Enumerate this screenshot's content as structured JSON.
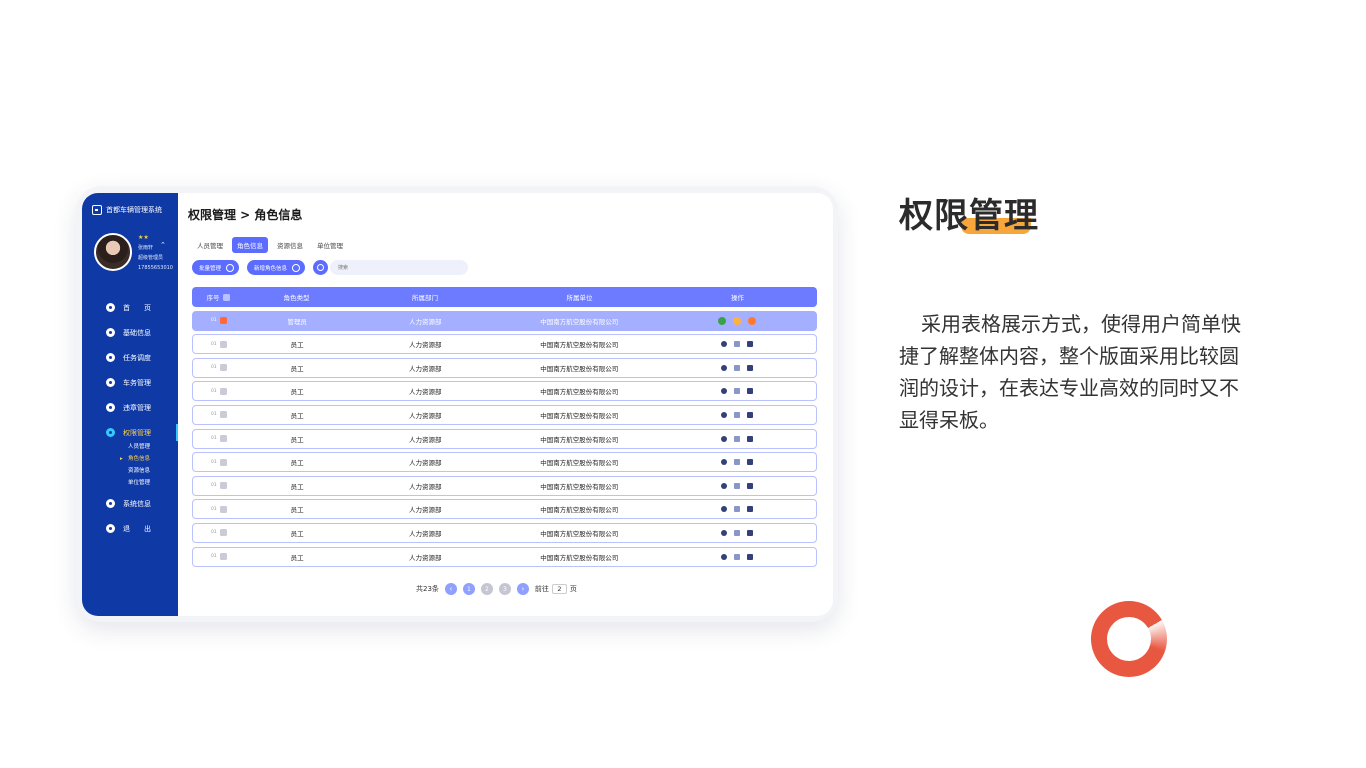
{
  "app": {
    "title": "首都车辆管理系统"
  },
  "user": {
    "name": "张雨轩",
    "role": "超级管理员",
    "phone": "17855653010"
  },
  "nav": {
    "items": [
      {
        "label": "首　　页"
      },
      {
        "label": "基础信息"
      },
      {
        "label": "任务调度"
      },
      {
        "label": "车务管理"
      },
      {
        "label": "违章管理"
      },
      {
        "label": "权限管理"
      },
      {
        "label": "系统信息"
      },
      {
        "label": "退　　出"
      }
    ],
    "sub": [
      "人员管理",
      "角色信息",
      "资源信息",
      "单位管理"
    ]
  },
  "breadcrumb": "权限管理 > 角色信息",
  "tabs": [
    "人员管理",
    "角色信息",
    "资源信息",
    "单位管理"
  ],
  "toolbar": {
    "batch_label": "批量管理",
    "add_label": "新增角色信息",
    "search_placeholder": "搜索"
  },
  "table": {
    "headers": [
      "序号",
      "角色类型",
      "所属部门",
      "所属单位",
      "操作"
    ],
    "rows": [
      {
        "no": "01",
        "role": "管理员",
        "dept": "人力资源部",
        "unit": "中国南方航空股份有限公司"
      },
      {
        "no": "01",
        "role": "员工",
        "dept": "人力资源部",
        "unit": "中国南方航空股份有限公司"
      },
      {
        "no": "01",
        "role": "员工",
        "dept": "人力资源部",
        "unit": "中国南方航空股份有限公司"
      },
      {
        "no": "01",
        "role": "员工",
        "dept": "人力资源部",
        "unit": "中国南方航空股份有限公司"
      },
      {
        "no": "01",
        "role": "员工",
        "dept": "人力资源部",
        "unit": "中国南方航空股份有限公司"
      },
      {
        "no": "01",
        "role": "员工",
        "dept": "人力资源部",
        "unit": "中国南方航空股份有限公司"
      },
      {
        "no": "01",
        "role": "员工",
        "dept": "人力资源部",
        "unit": "中国南方航空股份有限公司"
      },
      {
        "no": "01",
        "role": "员工",
        "dept": "人力资源部",
        "unit": "中国南方航空股份有限公司"
      },
      {
        "no": "01",
        "role": "员工",
        "dept": "人力资源部",
        "unit": "中国南方航空股份有限公司"
      },
      {
        "no": "01",
        "role": "员工",
        "dept": "人力资源部",
        "unit": "中国南方航空股份有限公司"
      },
      {
        "no": "01",
        "role": "员工",
        "dept": "人力资源部",
        "unit": "中国南方航空股份有限公司"
      }
    ]
  },
  "pagination": {
    "total": "共23条",
    "pages": [
      "1",
      "2",
      "3"
    ],
    "goto_label": "前往",
    "goto_value": "2",
    "page_suffix": "页"
  },
  "side_text": {
    "heading": "权限管理",
    "description": "采用表格展示方式，使得用户简单快捷了解整体内容，整个版面采用比较圆润的设计，在表达专业高效的同时又不显得呆板。"
  },
  "colors": {
    "sidebar": "#0f3aa6",
    "accent": "#5b6cff",
    "highlight": "#f7a63c",
    "ring": "#e8573f"
  }
}
